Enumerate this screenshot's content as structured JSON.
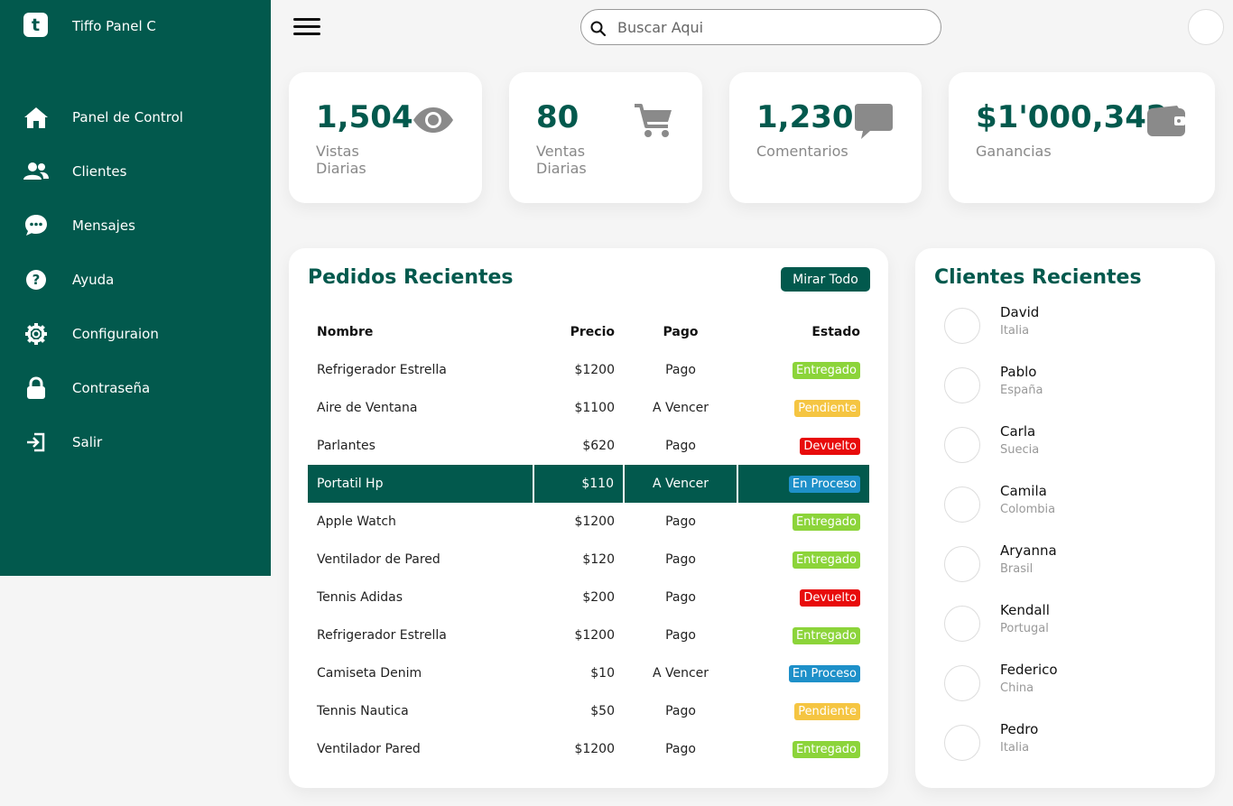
{
  "brand": {
    "logo_letter": "t",
    "name": "Tiffo Panel C"
  },
  "nav": [
    {
      "label": "Panel de Control",
      "icon": "home-icon"
    },
    {
      "label": "Clientes",
      "icon": "users-icon"
    },
    {
      "label": "Mensajes",
      "icon": "chat-icon"
    },
    {
      "label": "Ayuda",
      "icon": "help-icon"
    },
    {
      "label": "Configuraion",
      "icon": "gear-icon"
    },
    {
      "label": "Contraseña",
      "icon": "lock-icon"
    },
    {
      "label": "Salir",
      "icon": "logout-icon"
    }
  ],
  "search": {
    "placeholder": "Buscar Aqui"
  },
  "cards": [
    {
      "number": "1,504",
      "label_line1": "Vistas",
      "label_line2": "Diarias",
      "icon": "eye-icon"
    },
    {
      "number": "80",
      "label_line1": "Ventas",
      "label_line2": "Diarias",
      "icon": "cart-icon"
    },
    {
      "number": "1,230",
      "label_line1": "Comentarios",
      "label_line2": "",
      "icon": "comment-icon"
    },
    {
      "number": "$1'000,342",
      "label_line1": "Ganancias",
      "label_line2": "",
      "icon": "wallet-icon"
    }
  ],
  "orders": {
    "title": "Pedidos Recientes",
    "view_all": "Mirar Todo",
    "headers": [
      "Nombre",
      "Precio",
      "Pago",
      "Estado"
    ],
    "rows": [
      {
        "name": "Refrigerador Estrella",
        "price": "$1200",
        "payment": "Pago",
        "status": "Entregado",
        "status_color": "#8cd43a"
      },
      {
        "name": "Aire de Ventana",
        "price": "$1100",
        "payment": "A Vencer",
        "status": "Pendiente",
        "status_color": "#f5c542"
      },
      {
        "name": "Parlantes",
        "price": "$620",
        "payment": "Pago",
        "status": "Devuelto",
        "status_color": "#e80b0b"
      },
      {
        "name": "Portatil Hp",
        "price": "$110",
        "payment": "A Vencer",
        "status": "En Proceso",
        "status_color": "#1e90c9"
      },
      {
        "name": "Apple Watch",
        "price": "$1200",
        "payment": "Pago",
        "status": "Entregado",
        "status_color": "#8cd43a"
      },
      {
        "name": "Ventilador de Pared",
        "price": "$120",
        "payment": "Pago",
        "status": "Entregado",
        "status_color": "#8cd43a"
      },
      {
        "name": "Tennis Adidas",
        "price": "$200",
        "payment": "Pago",
        "status": "Devuelto",
        "status_color": "#e80b0b"
      },
      {
        "name": "Refrigerador Estrella",
        "price": "$1200",
        "payment": "Pago",
        "status": "Entregado",
        "status_color": "#8cd43a"
      },
      {
        "name": "Camiseta Denim",
        "price": "$10",
        "payment": "A Vencer",
        "status": "En Proceso",
        "status_color": "#1e90c9"
      },
      {
        "name": "Tennis Nautica",
        "price": "$50",
        "payment": "Pago",
        "status": "Pendiente",
        "status_color": "#f5c542"
      },
      {
        "name": "Ventilador Pared",
        "price": "$1200",
        "payment": "Pago",
        "status": "Entregado",
        "status_color": "#8cd43a"
      }
    ],
    "highlighted_row": 3
  },
  "clients": {
    "title": "Clientes Recientes",
    "items": [
      {
        "name": "David",
        "country": "Italia"
      },
      {
        "name": "Pablo",
        "country": "España"
      },
      {
        "name": "Carla",
        "country": "Suecia"
      },
      {
        "name": "Camila",
        "country": "Colombia"
      },
      {
        "name": "Aryanna",
        "country": "Brasil"
      },
      {
        "name": "Kendall",
        "country": "Portugal"
      },
      {
        "name": "Federico",
        "country": "China"
      },
      {
        "name": "Pedro",
        "country": "Italia"
      }
    ]
  },
  "colors": {
    "primary": "#02594d",
    "background": "#f5f5f5",
    "card": "#ffffff",
    "icon_gray": "#8a8a8a"
  }
}
